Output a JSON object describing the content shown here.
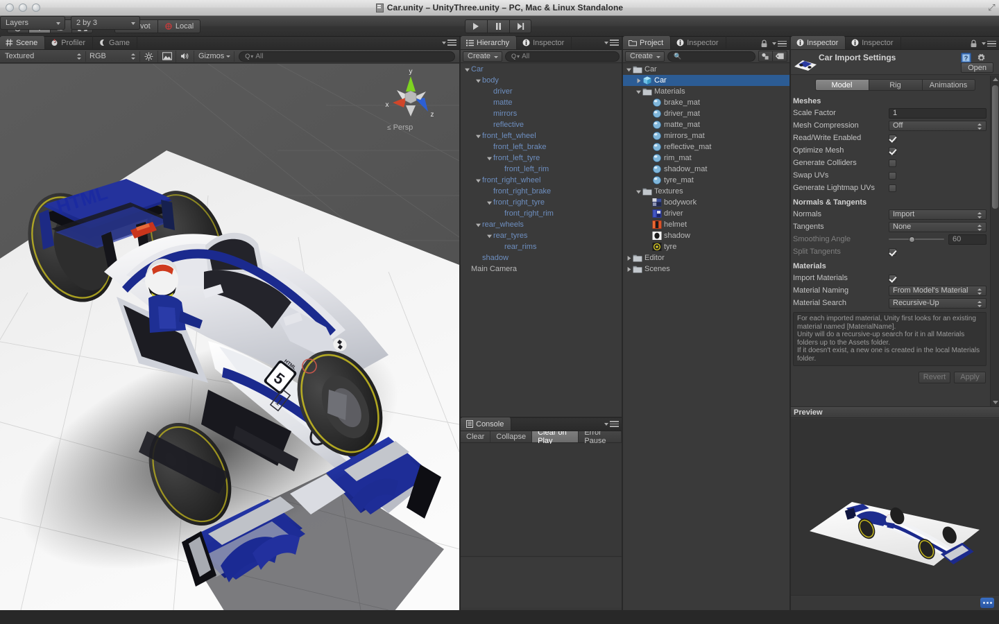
{
  "window": {
    "title": "Car.unity – UnityThree.unity – PC, Mac & Linux Standalone",
    "doc_icon": "unity-document-icon"
  },
  "toolbar": {
    "transform_tools": [
      {
        "name": "hand-tool",
        "icon": "hand-icon",
        "active": false
      },
      {
        "name": "move-tool",
        "icon": "move-arrows-icon",
        "active": true
      },
      {
        "name": "rotate-tool",
        "icon": "rotate-icon",
        "active": false
      },
      {
        "name": "scale-tool",
        "icon": "scale-icon",
        "active": false
      }
    ],
    "pivot_label": "Pivot",
    "local_label": "Local",
    "play_controls": [
      {
        "name": "play-button",
        "icon": "play-icon"
      },
      {
        "name": "pause-button",
        "icon": "pause-icon"
      },
      {
        "name": "step-button",
        "icon": "step-icon"
      }
    ],
    "layers_label": "Layers",
    "layout_label": "2 by 3"
  },
  "scene": {
    "tabs": [
      {
        "label": "Scene",
        "icon": "scene-grid-icon",
        "active": true
      },
      {
        "label": "Profiler",
        "icon": "profiler-icon",
        "active": false
      },
      {
        "label": "Game",
        "icon": "game-moon-icon",
        "active": false
      }
    ],
    "draw_mode": "Textured",
    "color_mode": "RGB",
    "lighting_icon": "sun-icon",
    "fx_icon": "image-icon",
    "audio_icon": "speaker-icon",
    "gizmos_label": "Gizmos",
    "search_placeholder": "All",
    "projection_label": "Persp",
    "axis_labels": {
      "x": "x",
      "y": "y",
      "z": "z"
    }
  },
  "hierarchy": {
    "tabs": [
      {
        "label": "Hierarchy",
        "icon": "hierarchy-icon",
        "active": true
      },
      {
        "label": "Inspector",
        "icon": "info-icon",
        "active": false
      }
    ],
    "create_label": "Create",
    "search_placeholder": "All",
    "items": [
      {
        "label": "Car",
        "indent": 0,
        "twist": "down",
        "style": "obj"
      },
      {
        "label": "body",
        "indent": 1,
        "twist": "down",
        "style": "obj"
      },
      {
        "label": "driver",
        "indent": 2,
        "twist": "none",
        "style": "obj"
      },
      {
        "label": "matte",
        "indent": 2,
        "twist": "none",
        "style": "obj"
      },
      {
        "label": "mirrors",
        "indent": 2,
        "twist": "none",
        "style": "obj"
      },
      {
        "label": "reflective",
        "indent": 2,
        "twist": "none",
        "style": "obj"
      },
      {
        "label": "front_left_wheel",
        "indent": 1,
        "twist": "down",
        "style": "obj"
      },
      {
        "label": "front_left_brake",
        "indent": 2,
        "twist": "none",
        "style": "obj"
      },
      {
        "label": "front_left_tyre",
        "indent": 2,
        "twist": "down",
        "style": "obj"
      },
      {
        "label": "front_left_rim",
        "indent": 3,
        "twist": "none",
        "style": "obj"
      },
      {
        "label": "front_right_wheel",
        "indent": 1,
        "twist": "down",
        "style": "obj"
      },
      {
        "label": "front_right_brake",
        "indent": 2,
        "twist": "none",
        "style": "obj"
      },
      {
        "label": "front_right_tyre",
        "indent": 2,
        "twist": "down",
        "style": "obj"
      },
      {
        "label": "front_right_rim",
        "indent": 3,
        "twist": "none",
        "style": "obj"
      },
      {
        "label": "rear_wheels",
        "indent": 1,
        "twist": "down",
        "style": "obj"
      },
      {
        "label": "rear_tyres",
        "indent": 2,
        "twist": "down",
        "style": "obj"
      },
      {
        "label": "rear_rims",
        "indent": 3,
        "twist": "none",
        "style": "obj"
      },
      {
        "label": "shadow",
        "indent": 1,
        "twist": "none",
        "style": "obj"
      },
      {
        "label": "Main Camera",
        "indent": 0,
        "twist": "none",
        "style": "plain"
      }
    ]
  },
  "project": {
    "tabs": [
      {
        "label": "Project",
        "icon": "folder-icon",
        "active": true
      },
      {
        "label": "Inspector",
        "icon": "info-icon",
        "active": false
      }
    ],
    "create_label": "Create",
    "search_placeholder": "",
    "toolbar_icons": [
      {
        "name": "filter-by-type-icon"
      },
      {
        "name": "filter-by-label-icon"
      }
    ],
    "items": [
      {
        "label": "Car",
        "indent": 0,
        "twist": "down",
        "icon": "folder",
        "selected": false
      },
      {
        "label": "Car",
        "indent": 1,
        "twist": "right",
        "icon": "prefab",
        "selected": true
      },
      {
        "label": "Materials",
        "indent": 1,
        "twist": "down",
        "icon": "folder",
        "selected": false
      },
      {
        "label": "brake_mat",
        "indent": 2,
        "twist": "none",
        "icon": "material",
        "selected": false
      },
      {
        "label": "driver_mat",
        "indent": 2,
        "twist": "none",
        "icon": "material",
        "selected": false
      },
      {
        "label": "matte_mat",
        "indent": 2,
        "twist": "none",
        "icon": "material",
        "selected": false
      },
      {
        "label": "mirrors_mat",
        "indent": 2,
        "twist": "none",
        "icon": "material",
        "selected": false
      },
      {
        "label": "reflective_mat",
        "indent": 2,
        "twist": "none",
        "icon": "material",
        "selected": false
      },
      {
        "label": "rim_mat",
        "indent": 2,
        "twist": "none",
        "icon": "material",
        "selected": false
      },
      {
        "label": "shadow_mat",
        "indent": 2,
        "twist": "none",
        "icon": "material",
        "selected": false
      },
      {
        "label": "tyre_mat",
        "indent": 2,
        "twist": "none",
        "icon": "material",
        "selected": false
      },
      {
        "label": "Textures",
        "indent": 1,
        "twist": "down",
        "icon": "folder",
        "selected": false
      },
      {
        "label": "bodywork",
        "indent": 2,
        "twist": "none",
        "icon": "tex-bodywork",
        "selected": false
      },
      {
        "label": "driver",
        "indent": 2,
        "twist": "none",
        "icon": "tex-driver",
        "selected": false
      },
      {
        "label": "helmet",
        "indent": 2,
        "twist": "none",
        "icon": "tex-helmet",
        "selected": false
      },
      {
        "label": "shadow",
        "indent": 2,
        "twist": "none",
        "icon": "tex-shadow",
        "selected": false
      },
      {
        "label": "tyre",
        "indent": 2,
        "twist": "none",
        "icon": "tex-tyre",
        "selected": false
      },
      {
        "label": "Editor",
        "indent": 0,
        "twist": "right",
        "icon": "folder",
        "selected": false
      },
      {
        "label": "Scenes",
        "indent": 0,
        "twist": "right",
        "icon": "folder",
        "selected": false
      }
    ]
  },
  "inspector": {
    "tabs": [
      {
        "label": "Inspector",
        "icon": "info-icon",
        "active": true
      },
      {
        "label": "Inspector",
        "icon": "info-icon",
        "active": false
      }
    ],
    "lock_icon": "lock-icon",
    "title": "Car Import Settings",
    "help_icon": "help-book-icon",
    "settings_icon": "gear-icon",
    "open_label": "Open",
    "mode_tabs": [
      {
        "label": "Model",
        "active": true
      },
      {
        "label": "Rig",
        "active": false
      },
      {
        "label": "Animations",
        "active": false
      }
    ],
    "sections": {
      "meshes_title": "Meshes",
      "scale_factor_label": "Scale Factor",
      "scale_factor_value": "1",
      "mesh_compression_label": "Mesh Compression",
      "mesh_compression_value": "Off",
      "read_write_label": "Read/Write Enabled",
      "read_write_checked": true,
      "optimize_mesh_label": "Optimize Mesh",
      "optimize_mesh_checked": true,
      "generate_colliders_label": "Generate Colliders",
      "generate_colliders_checked": false,
      "swap_uvs_label": "Swap UVs",
      "swap_uvs_checked": false,
      "generate_lightmap_label": "Generate Lightmap UVs",
      "generate_lightmap_checked": false,
      "normals_title": "Normals & Tangents",
      "normals_label": "Normals",
      "normals_value": "Import",
      "tangents_label": "Tangents",
      "tangents_value": "None",
      "smoothing_angle_label": "Smoothing Angle",
      "smoothing_angle_value": "60",
      "split_tangents_label": "Split Tangents",
      "split_tangents_checked": true,
      "materials_title": "Materials",
      "import_materials_label": "Import Materials",
      "import_materials_checked": true,
      "material_naming_label": "Material Naming",
      "material_naming_value": "From Model's Material",
      "material_search_label": "Material Search",
      "material_search_value": "Recursive-Up",
      "help_text": "For each imported material, Unity first looks for an existing material named [MaterialName].\nUnity will do a recursive-up search for it in all Materials folders up to the Assets folder.\nIf it doesn't exist, a new one is created in the local Materials folder."
    },
    "revert_label": "Revert",
    "apply_label": "Apply",
    "preview_label": "Preview",
    "preview_options_icon": "preview-options-icon"
  },
  "console": {
    "tabs": [
      {
        "label": "Console",
        "icon": "console-icon",
        "active": true
      }
    ],
    "buttons": [
      {
        "label": "Clear",
        "active": false
      },
      {
        "label": "Collapse",
        "active": false
      },
      {
        "label": "Clear on Play",
        "active": true
      },
      {
        "label": "Error Pause",
        "active": false
      }
    ]
  },
  "colors": {
    "accent_selection": "#2c5c94",
    "hierarchy_label": "#6e8fc0",
    "panel_bg": "#383838",
    "car_blue": "#1c2f9e",
    "toolbar_bg": "#3a3a3a"
  }
}
